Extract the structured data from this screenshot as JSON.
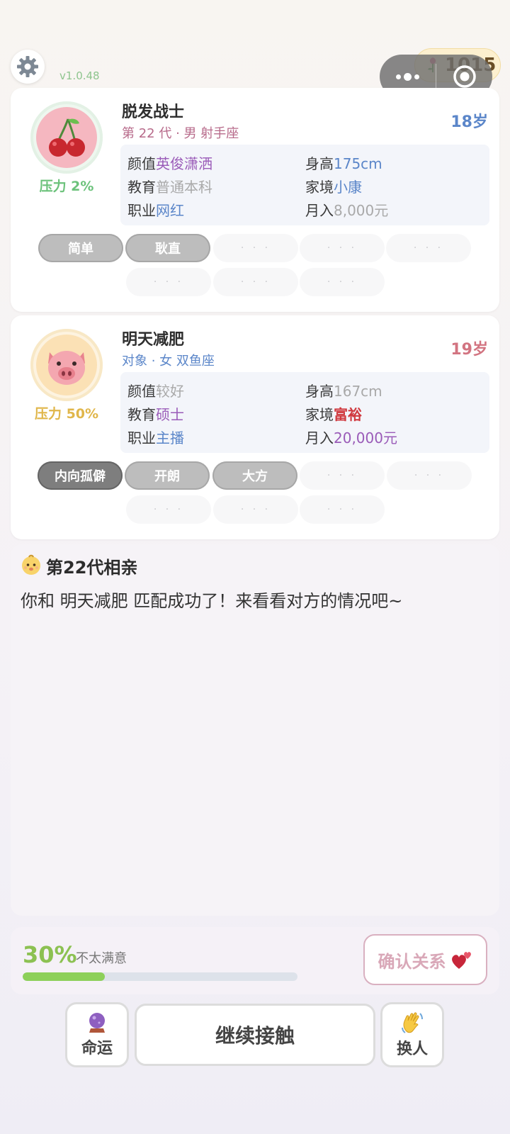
{
  "top": {
    "version": "v1.0.48",
    "coins": "1015",
    "settings_icon": "gear-icon"
  },
  "player": {
    "name": "脱发战士",
    "subtitle": "第 22 代 · 男 射手座",
    "age": "18岁",
    "pressure": "压力 2%",
    "avatar_icon": "cherry-icon",
    "stats": {
      "looks_k": "颜值",
      "looks_v": "英俊潇洒",
      "height_k": "身高",
      "height_v": "175cm",
      "edu_k": "教育",
      "edu_v": "普通本科",
      "family_k": "家境",
      "family_v": "小康",
      "job_k": "职业",
      "job_v": "网红",
      "income_k": "月入",
      "income_v": "8,000元"
    },
    "tags": [
      "简单",
      "耿直",
      "· · ·",
      "· · ·",
      "· · ·",
      "· · ·",
      "· · ·",
      "· · ·"
    ]
  },
  "partner": {
    "name": "明天减肥",
    "subtitle": "对象 · 女 双鱼座",
    "age": "19岁",
    "pressure": "压力 50%",
    "avatar_icon": "pig-icon",
    "stats": {
      "looks_k": "颜值",
      "looks_v": "较好",
      "height_k": "身高",
      "height_v": "167cm",
      "edu_k": "教育",
      "edu_v": "硕士",
      "family_k": "家境",
      "family_v": "富裕",
      "job_k": "职业",
      "job_v": "主播",
      "income_k": "月入",
      "income_v": "20,000元"
    },
    "tags": [
      "内向孤僻",
      "开朗",
      "大方",
      "· · ·",
      "· · ·",
      "· · ·",
      "· · ·",
      "· · ·"
    ]
  },
  "log": {
    "title": "第22代相亲",
    "message": "你和 明天减肥 匹配成功了！来看看对方的情况吧~"
  },
  "satisfaction": {
    "percent": "30%",
    "progress": 0.3,
    "label": "不太满意",
    "confirm_label": "确认关系"
  },
  "actions": {
    "fate_label": "命运",
    "continue_label": "继续接触",
    "swap_label": "换人"
  },
  "colors": {
    "accent_green": "#8cc152",
    "age_blue": "#5b86c9",
    "age_pink": "#d27481",
    "pressure_green": "#6cc27b",
    "pressure_yellow": "#e0b64a"
  }
}
